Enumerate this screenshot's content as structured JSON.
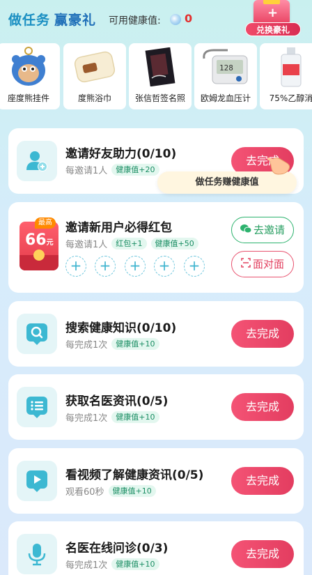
{
  "header": {
    "title_part1": "做任务",
    "title_part2": "赢豪礼",
    "points_label": "可用健康值:",
    "points_value": "0",
    "exchange_label": "兑换豪礼"
  },
  "prizes": [
    {
      "name": "座度熊挂件"
    },
    {
      "name": "度熊浴巾"
    },
    {
      "name": "张信哲签名照"
    },
    {
      "name": "欧姆龙血压计"
    },
    {
      "name": "75%乙醇消"
    }
  ],
  "tooltip": "做任务赚健康值",
  "tasks": [
    {
      "title": "邀请好友助力(0/10)",
      "sub": "每邀请1人",
      "tag": "健康值+20",
      "button": "去完成"
    },
    {
      "title": "邀请新用户必得红包",
      "sub": "每邀请1人",
      "tag1": "红包+1",
      "tag2": "健康值+50",
      "redpack_badge": "最高",
      "redpack_amount": "66",
      "redpack_unit": "元",
      "invite_button": "去邀请",
      "facetoface_button": "面对面",
      "slot_symbol": "+"
    },
    {
      "title": "搜索健康知识(0/10)",
      "sub": "每完成1次",
      "tag": "健康值+10",
      "button": "去完成"
    },
    {
      "title": "获取名医资讯(0/5)",
      "sub": "每完成1次",
      "tag": "健康值+10",
      "button": "去完成"
    },
    {
      "title": "看视频了解健康资讯(0/5)",
      "sub": "观看60秒",
      "tag": "健康值+10",
      "button": "去完成"
    },
    {
      "title": "名医在线问诊(0/3)",
      "sub": "每完成1次",
      "tag": "健康值+10",
      "button": "去完成"
    }
  ],
  "colors": {
    "accent_pink": "#e33d60",
    "accent_green": "#2db36e",
    "title_blue": "#1a8fc2",
    "icon_teal": "#3cb8d2"
  }
}
